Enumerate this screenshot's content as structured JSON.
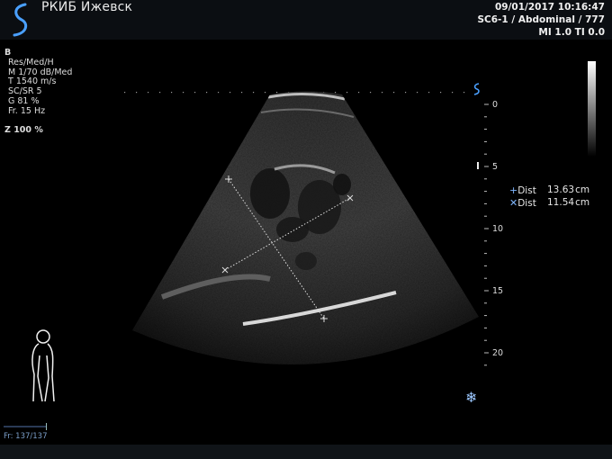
{
  "header": {
    "hospital": "РКИБ Ижевск",
    "datetime": "09/01/2017 10:16:47",
    "probe": "SC6-1 / Abdominal / 777",
    "indices": "MI 1.0  TI 0.0"
  },
  "params": {
    "mode": "B",
    "lines": [
      "Res/Med/H",
      "M 1/70 dB/Med",
      "T 1540 m/s",
      "SC/SR 5",
      "G 81 %",
      "Fr. 15 Hz"
    ],
    "zoom": "Z  100  %"
  },
  "depth_scale": {
    "labels": [
      "0",
      "5",
      "10",
      "15",
      "20"
    ]
  },
  "measurements": [
    {
      "marker": "+",
      "label": "Dist",
      "value": "13.63",
      "unit": "cm"
    },
    {
      "marker": "✕",
      "label": "Dist",
      "value": "11.54",
      "unit": "cm"
    }
  ],
  "frame_counter": "Fr: 137/137",
  "icons": {
    "logo": "samsung-s-logo-icon",
    "probe_orientation": "s-marker-icon",
    "body_marker": "body-marker-icon",
    "freeze": "snowflake-icon"
  }
}
